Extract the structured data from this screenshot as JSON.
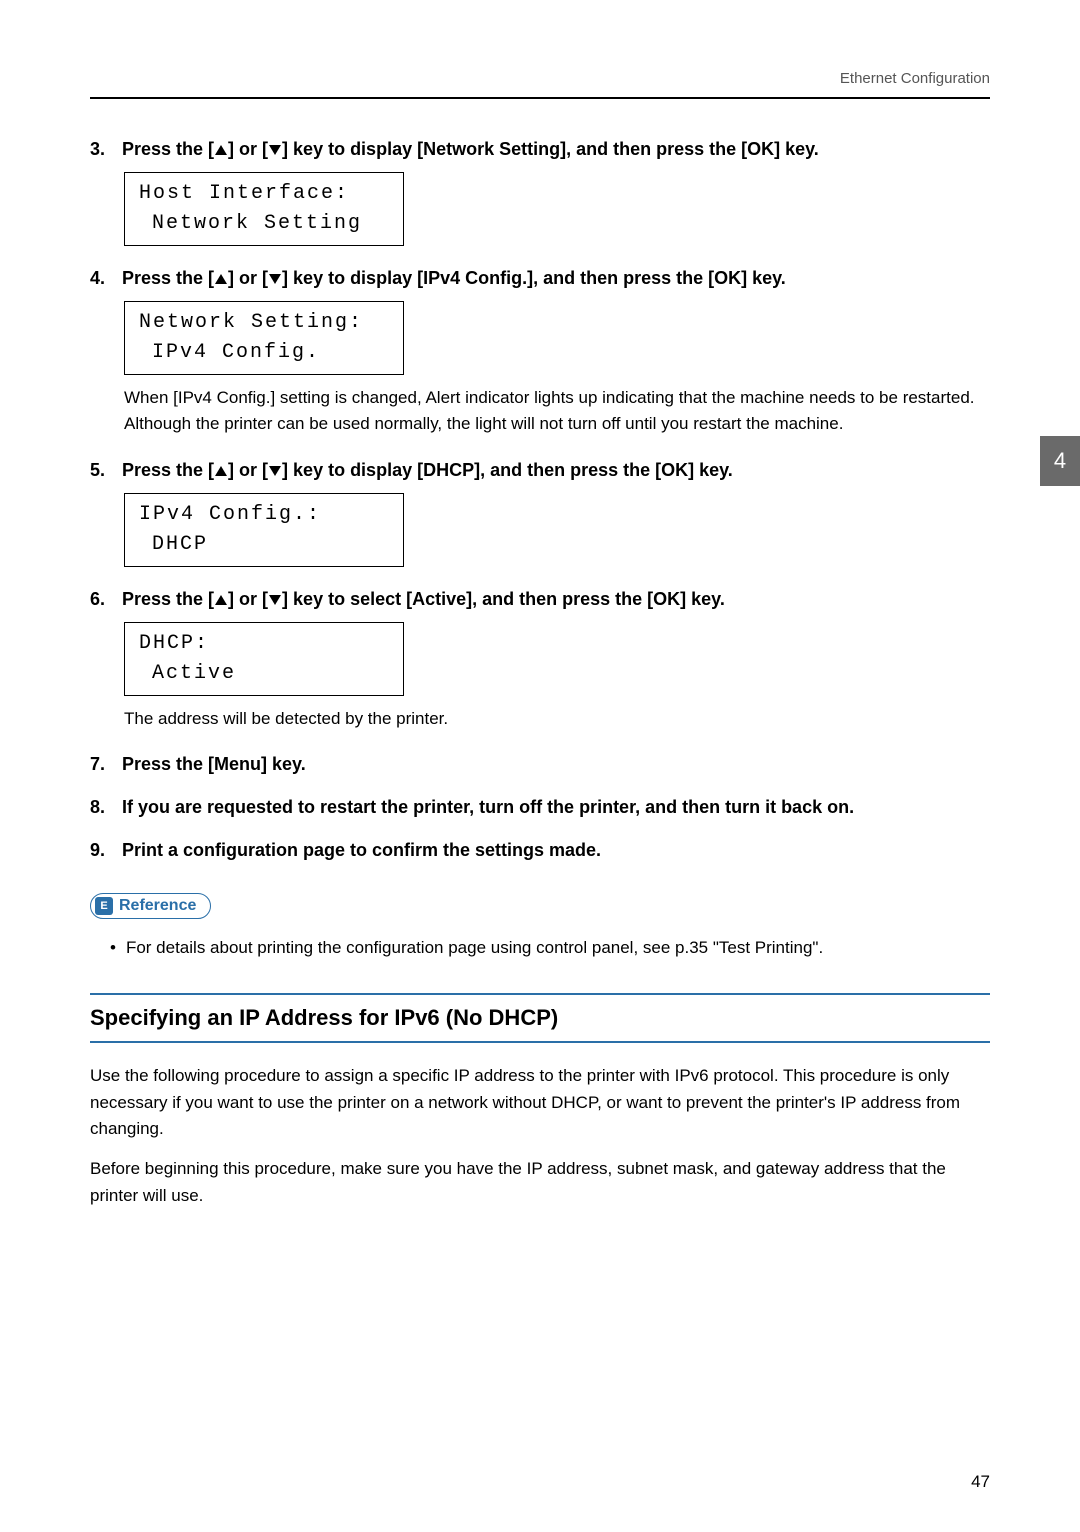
{
  "header": {
    "right_text": "Ethernet Configuration"
  },
  "steps": {
    "s3": {
      "num": "3.",
      "t1": "Press the [",
      "t2": "] or [",
      "t3": "] key to display [Network Setting], and then press the [OK] key.",
      "lcd_l1": "Host Interface:",
      "lcd_l2": "Network Setting"
    },
    "s4": {
      "num": "4.",
      "t1": "Press the [",
      "t2": "] or [",
      "t3": "] key to display [IPv4 Config.], and then press the [OK] key.",
      "lcd_l1": "Network Setting:",
      "lcd_l2": "IPv4 Config.",
      "note": "When [IPv4 Config.] setting is changed, Alert indicator lights up indicating that the machine needs to be restarted. Although the printer can be used normally, the light will not turn off until you restart the machine."
    },
    "s5": {
      "num": "5.",
      "t1": "Press the [",
      "t2": "] or [",
      "t3": "] key to display [DHCP], and then press the [OK] key.",
      "lcd_l1": "IPv4 Config.:",
      "lcd_l2": "DHCP"
    },
    "s6": {
      "num": "6.",
      "t1": "Press the [",
      "t2": "] or [",
      "t3": "] key to select [Active], and then press the [OK] key.",
      "lcd_l1": "DHCP:",
      "lcd_l2": "Active",
      "note": "The address will be detected by the printer."
    },
    "s7": {
      "num": "7.",
      "text": "Press the [Menu] key."
    },
    "s8": {
      "num": "8.",
      "text": "If you are requested to restart the printer, turn off the printer, and then turn it back on."
    },
    "s9": {
      "num": "9.",
      "text": "Print a configuration page to confirm the settings made."
    }
  },
  "reference": {
    "icon": "E",
    "label": "Reference",
    "bullet": "For details about printing the configuration page using control panel, see p.35 \"Test Printing\"."
  },
  "section": {
    "title": "Specifying an IP Address for IPv6 (No DHCP)",
    "p1": "Use the following procedure to assign a specific IP address to the printer with IPv6 protocol. This procedure is only necessary if you want to use the printer on a network without DHCP, or want to prevent the printer's IP address from changing.",
    "p2": "Before beginning this procedure, make sure you have the IP address, subnet mask, and gateway address that the printer will use."
  },
  "side_tab": "4",
  "page_number": "47"
}
